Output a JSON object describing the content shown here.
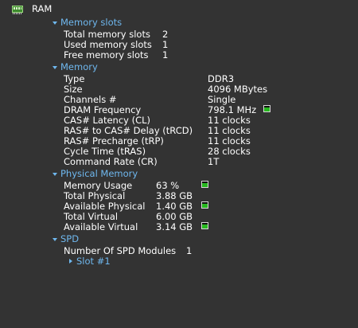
{
  "root": {
    "label": "RAM"
  },
  "memory_slots": {
    "header": "Memory slots",
    "rows": [
      {
        "label": "Total memory slots",
        "value": "2"
      },
      {
        "label": "Used memory slots",
        "value": "1"
      },
      {
        "label": "Free memory slots",
        "value": "1"
      }
    ]
  },
  "memory": {
    "header": "Memory",
    "rows": [
      {
        "label": "Type",
        "value": "DDR3"
      },
      {
        "label": "Size",
        "value": "4096 MBytes"
      },
      {
        "label": "Channels #",
        "value": "Single"
      },
      {
        "label": "DRAM Frequency",
        "value": "798.1 MHz"
      },
      {
        "label": "CAS# Latency (CL)",
        "value": "11 clocks"
      },
      {
        "label": "RAS# to CAS# Delay (tRCD)",
        "value": "11 clocks"
      },
      {
        "label": "RAS# Precharge (tRP)",
        "value": "11 clocks"
      },
      {
        "label": "Cycle Time (tRAS)",
        "value": "28 clocks"
      },
      {
        "label": "Command Rate (CR)",
        "value": "1T"
      }
    ]
  },
  "physical_memory": {
    "header": "Physical Memory",
    "rows": [
      {
        "label": "Memory Usage",
        "value": "63 %"
      },
      {
        "label": "Total Physical",
        "value": "3.88 GB"
      },
      {
        "label": "Available Physical",
        "value": "1.40 GB"
      },
      {
        "label": "Total Virtual",
        "value": "6.00 GB"
      },
      {
        "label": "Available Virtual",
        "value": "3.14 GB"
      }
    ]
  },
  "spd": {
    "header": "SPD",
    "rows": [
      {
        "label": "Number Of SPD Modules",
        "value": "1"
      }
    ],
    "slot_label": "Slot #1"
  },
  "icons": {
    "ram": "ram-module-icon",
    "expanded": "chevron-down-icon",
    "collapsed": "chevron-right-icon",
    "gauge": "green-gauge-icon"
  },
  "colors": {
    "background": "#333333",
    "text": "#ffffff",
    "section_header": "#6fb8ef",
    "gauge": "#27b81f"
  }
}
